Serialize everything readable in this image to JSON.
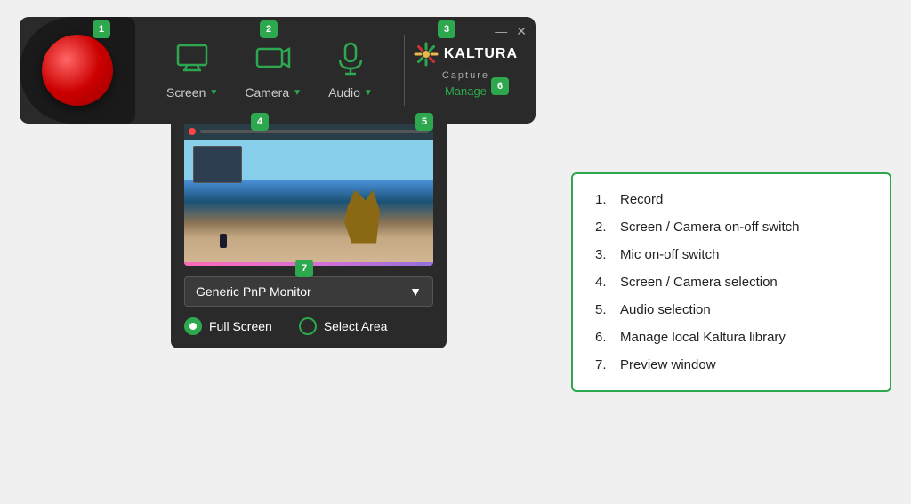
{
  "toolbar": {
    "title": "Kaltura Capture",
    "manage_label": "Manage",
    "brand_name": "KALTURA",
    "capture_label": "Capture",
    "window_minimize": "—",
    "window_close": "✕"
  },
  "controls": {
    "screen_label": "Screen",
    "camera_label": "Camera",
    "audio_label": "Audio"
  },
  "badges": {
    "b1": "1",
    "b2": "2",
    "b3": "3",
    "b4": "4",
    "b5": "5",
    "b6": "6",
    "b7": "7"
  },
  "preview": {
    "monitor_label": "Generic PnP Monitor",
    "full_screen_label": "Full Screen",
    "select_area_label": "Select Area"
  },
  "info_list": [
    {
      "num": "1.",
      "text": "Record"
    },
    {
      "num": "2.",
      "text": "Screen / Camera on-off switch"
    },
    {
      "num": "3.",
      "text": "Mic on-off switch"
    },
    {
      "num": "4.",
      "text": "Screen / Camera selection"
    },
    {
      "num": "5.",
      "text": "Audio selection"
    },
    {
      "num": "6.",
      "text": "Manage local Kaltura library"
    },
    {
      "num": "7.",
      "text": "Preview window"
    }
  ]
}
